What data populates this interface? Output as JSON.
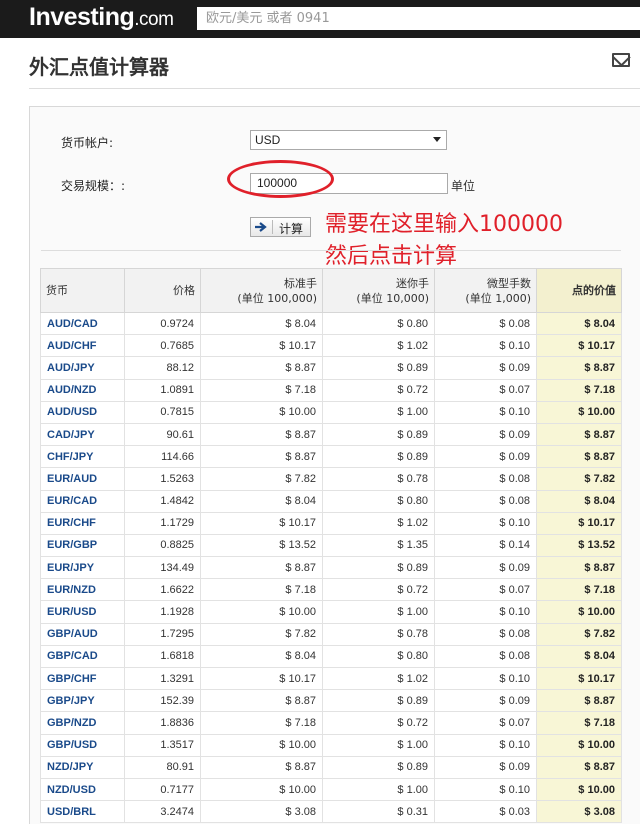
{
  "header": {
    "logo_main": "Investing",
    "logo_suffix": ".com",
    "search_placeholder": "欧元/美元 或者 0941"
  },
  "page": {
    "title": "外汇点值计算器"
  },
  "form": {
    "currency_label": "货币帐户:",
    "currency_value": "USD",
    "size_label": "交易规模：:",
    "size_value": "100000",
    "size_unit": "单位",
    "calc_button": "计算"
  },
  "annotation": {
    "line1": "需要在这里输入100000",
    "line2": "然后点击计算"
  },
  "table": {
    "headers": {
      "pair": "货币",
      "price": "价格",
      "std_lot": "标准手",
      "std_lot_unit": "(单位 100,000)",
      "mini_lot": "迷你手",
      "mini_lot_unit": "(单位 10,000)",
      "micro_lot": "微型手数",
      "micro_lot_unit": "(单位 1,000)",
      "pip_value": "点的价值"
    },
    "rows": [
      {
        "pair": "AUD/CAD",
        "price": "0.9724",
        "std": "$ 8.04",
        "mini": "$ 0.80",
        "micro": "$ 0.08",
        "pip": "$ 8.04"
      },
      {
        "pair": "AUD/CHF",
        "price": "0.7685",
        "std": "$ 10.17",
        "mini": "$ 1.02",
        "micro": "$ 0.10",
        "pip": "$ 10.17"
      },
      {
        "pair": "AUD/JPY",
        "price": "88.12",
        "std": "$ 8.87",
        "mini": "$ 0.89",
        "micro": "$ 0.09",
        "pip": "$ 8.87"
      },
      {
        "pair": "AUD/NZD",
        "price": "1.0891",
        "std": "$ 7.18",
        "mini": "$ 0.72",
        "micro": "$ 0.07",
        "pip": "$ 7.18"
      },
      {
        "pair": "AUD/USD",
        "price": "0.7815",
        "std": "$ 10.00",
        "mini": "$ 1.00",
        "micro": "$ 0.10",
        "pip": "$ 10.00"
      },
      {
        "pair": "CAD/JPY",
        "price": "90.61",
        "std": "$ 8.87",
        "mini": "$ 0.89",
        "micro": "$ 0.09",
        "pip": "$ 8.87"
      },
      {
        "pair": "CHF/JPY",
        "price": "114.66",
        "std": "$ 8.87",
        "mini": "$ 0.89",
        "micro": "$ 0.09",
        "pip": "$ 8.87"
      },
      {
        "pair": "EUR/AUD",
        "price": "1.5263",
        "std": "$ 7.82",
        "mini": "$ 0.78",
        "micro": "$ 0.08",
        "pip": "$ 7.82"
      },
      {
        "pair": "EUR/CAD",
        "price": "1.4842",
        "std": "$ 8.04",
        "mini": "$ 0.80",
        "micro": "$ 0.08",
        "pip": "$ 8.04"
      },
      {
        "pair": "EUR/CHF",
        "price": "1.1729",
        "std": "$ 10.17",
        "mini": "$ 1.02",
        "micro": "$ 0.10",
        "pip": "$ 10.17"
      },
      {
        "pair": "EUR/GBP",
        "price": "0.8825",
        "std": "$ 13.52",
        "mini": "$ 1.35",
        "micro": "$ 0.14",
        "pip": "$ 13.52"
      },
      {
        "pair": "EUR/JPY",
        "price": "134.49",
        "std": "$ 8.87",
        "mini": "$ 0.89",
        "micro": "$ 0.09",
        "pip": "$ 8.87"
      },
      {
        "pair": "EUR/NZD",
        "price": "1.6622",
        "std": "$ 7.18",
        "mini": "$ 0.72",
        "micro": "$ 0.07",
        "pip": "$ 7.18"
      },
      {
        "pair": "EUR/USD",
        "price": "1.1928",
        "std": "$ 10.00",
        "mini": "$ 1.00",
        "micro": "$ 0.10",
        "pip": "$ 10.00"
      },
      {
        "pair": "GBP/AUD",
        "price": "1.7295",
        "std": "$ 7.82",
        "mini": "$ 0.78",
        "micro": "$ 0.08",
        "pip": "$ 7.82"
      },
      {
        "pair": "GBP/CAD",
        "price": "1.6818",
        "std": "$ 8.04",
        "mini": "$ 0.80",
        "micro": "$ 0.08",
        "pip": "$ 8.04"
      },
      {
        "pair": "GBP/CHF",
        "price": "1.3291",
        "std": "$ 10.17",
        "mini": "$ 1.02",
        "micro": "$ 0.10",
        "pip": "$ 10.17"
      },
      {
        "pair": "GBP/JPY",
        "price": "152.39",
        "std": "$ 8.87",
        "mini": "$ 0.89",
        "micro": "$ 0.09",
        "pip": "$ 8.87"
      },
      {
        "pair": "GBP/NZD",
        "price": "1.8836",
        "std": "$ 7.18",
        "mini": "$ 0.72",
        "micro": "$ 0.07",
        "pip": "$ 7.18"
      },
      {
        "pair": "GBP/USD",
        "price": "1.3517",
        "std": "$ 10.00",
        "mini": "$ 1.00",
        "micro": "$ 0.10",
        "pip": "$ 10.00"
      },
      {
        "pair": "NZD/JPY",
        "price": "80.91",
        "std": "$ 8.87",
        "mini": "$ 0.89",
        "micro": "$ 0.09",
        "pip": "$ 8.87"
      },
      {
        "pair": "NZD/USD",
        "price": "0.7177",
        "std": "$ 10.00",
        "mini": "$ 1.00",
        "micro": "$ 0.10",
        "pip": "$ 10.00"
      },
      {
        "pair": "USD/BRL",
        "price": "3.2474",
        "std": "$ 3.08",
        "mini": "$ 0.31",
        "micro": "$ 0.03",
        "pip": "$ 3.08"
      }
    ]
  },
  "colors": {
    "topbar": "#1b1b1b",
    "pair_link": "#1a4a8a",
    "pip_column": "#f8f6d6",
    "annotation_red": "#e0202a"
  }
}
